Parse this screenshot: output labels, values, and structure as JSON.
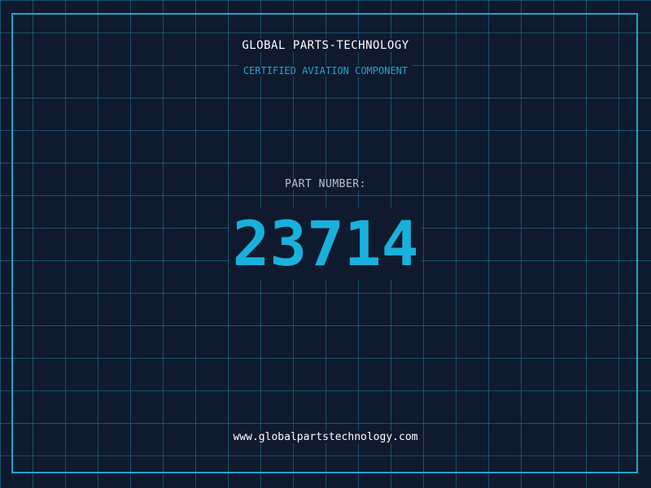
{
  "header": {
    "brand": "GLOBAL PARTS-TECHNOLOGY",
    "subtitle": "CERTIFIED AVIATION COMPONENT"
  },
  "part": {
    "label": "PART NUMBER:",
    "number": "23714"
  },
  "footer": {
    "website": "www.globalpartstechnology.com"
  },
  "colors": {
    "background": "#0f1a2e",
    "grid": "#1f7fa0",
    "accent": "#1ea7cf",
    "number": "#19b1dc",
    "text": "#ffffff",
    "muted": "#b9c3cf"
  }
}
